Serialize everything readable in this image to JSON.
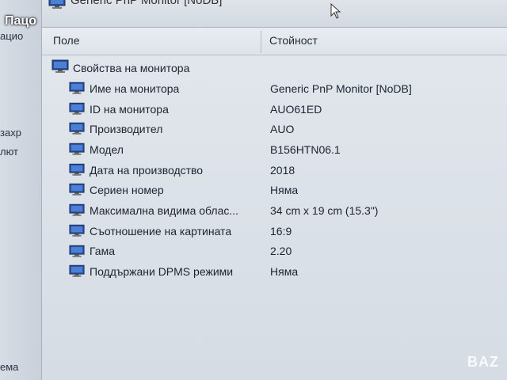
{
  "overlay_label": "Пацо",
  "top_strip_text": "Generic PnP Monitor [NoDB]",
  "left_fragments": [
    "ацио",
    "захр",
    "лют",
    "ема"
  ],
  "columns": {
    "field": "Поле",
    "value": "Стойност"
  },
  "group": {
    "label": "Свойства на монитора",
    "icon": "monitor-icon"
  },
  "rows": [
    {
      "field": "Име на монитора",
      "value": "Generic PnP Monitor [NoDB]"
    },
    {
      "field": "ID на монитора",
      "value": "AUO61ED"
    },
    {
      "field": "Производител",
      "value": "AUO"
    },
    {
      "field": "Модел",
      "value": "B156HTN06.1"
    },
    {
      "field": "Дата на производство",
      "value": "2018"
    },
    {
      "field": "Сериен номер",
      "value": "Няма"
    },
    {
      "field": "Максимална видима облас...",
      "value": "34 cm x 19 cm (15.3\")"
    },
    {
      "field": "Съотношение на картината",
      "value": "16:9"
    },
    {
      "field": "Гама",
      "value": "2.20"
    },
    {
      "field": "Поддържани DPMS режими",
      "value": "Няма"
    }
  ],
  "watermark": "BAZ"
}
